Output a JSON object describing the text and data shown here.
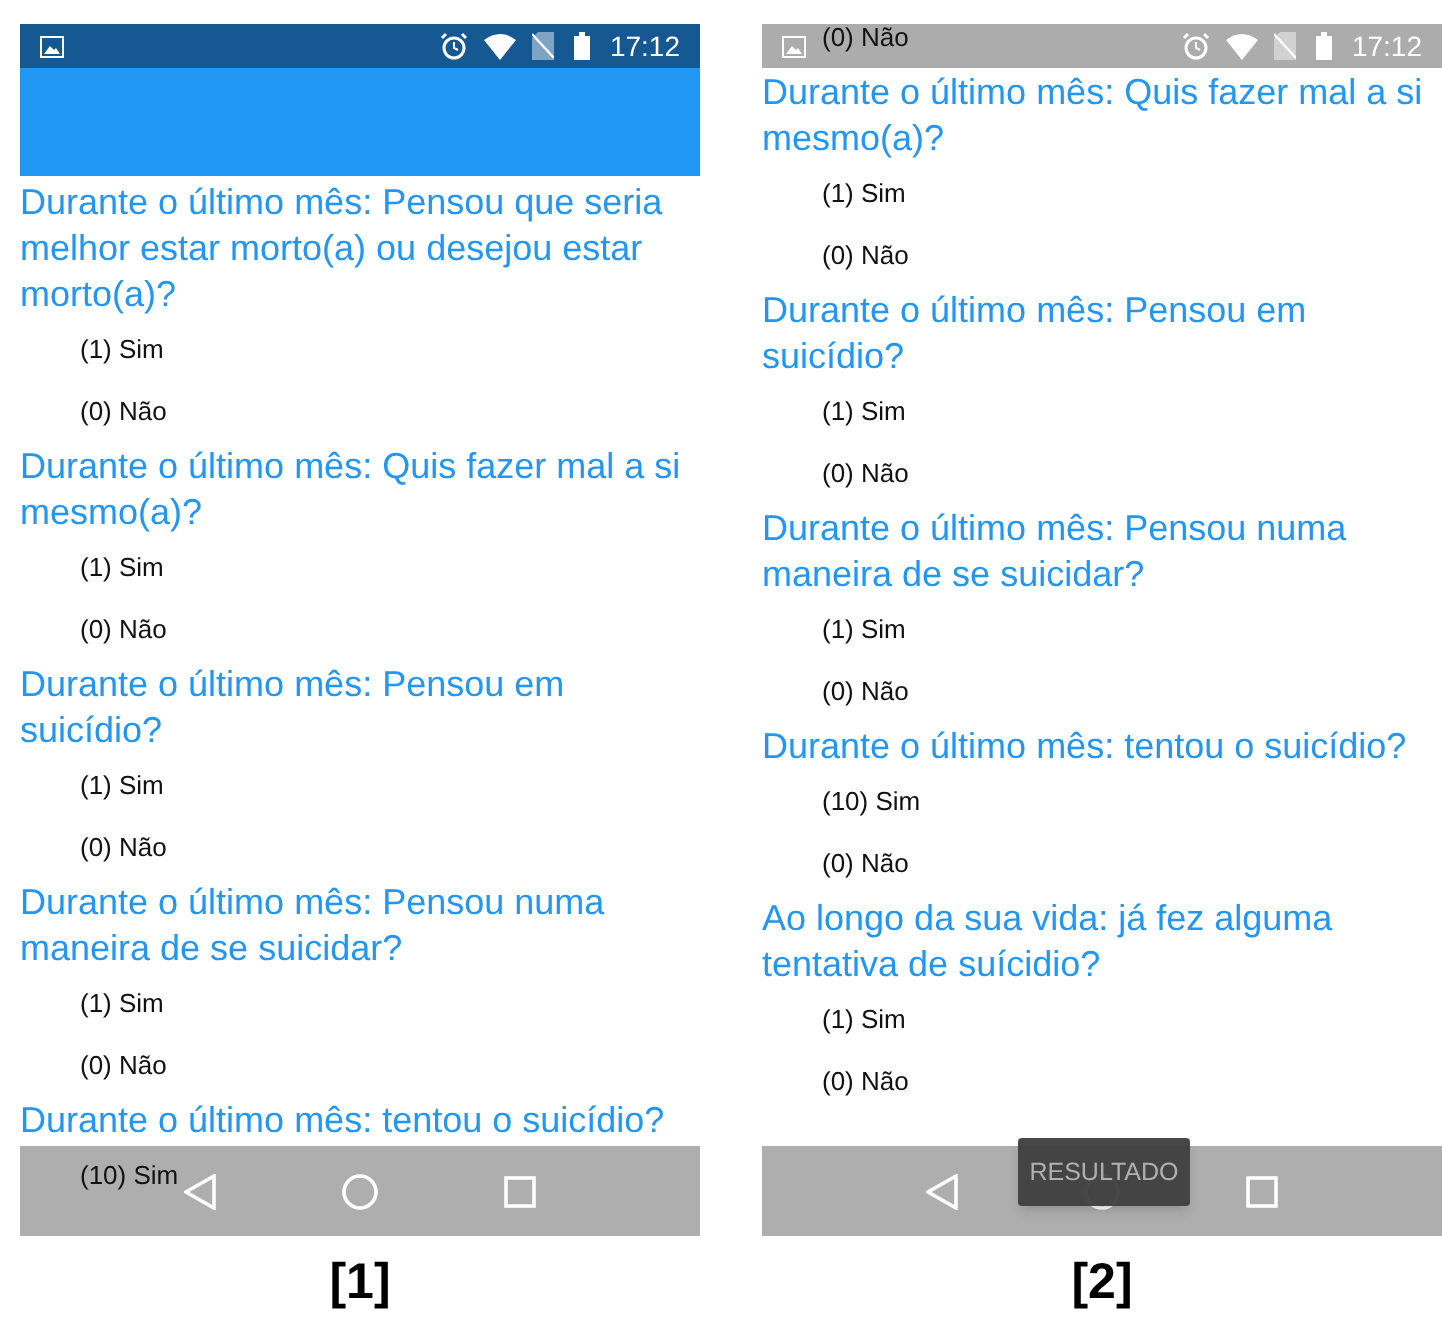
{
  "screens": [
    {
      "label": "[1]",
      "status_bar": {
        "time": "17:12",
        "translucent": false
      },
      "app_bar_visible": true,
      "items": [
        {
          "kind": "question",
          "text": "Durante o último mês: Pensou que seria melhor estar morto(a) ou desejou estar morto(a)?"
        },
        {
          "kind": "option",
          "text": "(1) Sim"
        },
        {
          "kind": "option",
          "text": "(0) Não"
        },
        {
          "kind": "question",
          "text": "Durante o último mês: Quis fazer mal a si mesmo(a)?"
        },
        {
          "kind": "option",
          "text": "(1) Sim"
        },
        {
          "kind": "option",
          "text": "(0) Não"
        },
        {
          "kind": "question",
          "text": "Durante o último mês: Pensou em suicídio?"
        },
        {
          "kind": "option",
          "text": "(1) Sim"
        },
        {
          "kind": "option",
          "text": "(0) Não"
        },
        {
          "kind": "question",
          "text": "Durante o último mês: Pensou numa maneira de se suicidar?"
        },
        {
          "kind": "option",
          "text": "(1) Sim"
        },
        {
          "kind": "option",
          "text": "(0) Não"
        },
        {
          "kind": "question",
          "text": "Durante o último mês: tentou o suicídio?"
        },
        {
          "kind": "option",
          "text": "(10) Sim"
        }
      ]
    },
    {
      "label": "[2]",
      "status_bar": {
        "time": "17:12",
        "translucent": true
      },
      "app_bar_visible": false,
      "floating_button": "RESULTADO",
      "items": [
        {
          "kind": "option",
          "text": "(0) Não"
        },
        {
          "kind": "question",
          "text": "Durante o último mês: Quis fazer mal a si mesmo(a)?"
        },
        {
          "kind": "option",
          "text": "(1) Sim"
        },
        {
          "kind": "option",
          "text": "(0) Não"
        },
        {
          "kind": "question",
          "text": "Durante o último mês: Pensou em suicídio?"
        },
        {
          "kind": "option",
          "text": "(1) Sim"
        },
        {
          "kind": "option",
          "text": "(0) Não"
        },
        {
          "kind": "question",
          "text": "Durante o último mês: Pensou numa maneira de se suicidar?"
        },
        {
          "kind": "option",
          "text": "(1) Sim"
        },
        {
          "kind": "option",
          "text": "(0) Não"
        },
        {
          "kind": "question",
          "text": "Durante o último mês: tentou o suicídio?"
        },
        {
          "kind": "option",
          "text": "(10) Sim"
        },
        {
          "kind": "option",
          "text": "(0) Não"
        },
        {
          "kind": "question",
          "text": "Ao longo da sua vida: já fez alguma tentativa de suícidio?"
        },
        {
          "kind": "option",
          "text": "(1) Sim"
        },
        {
          "kind": "option",
          "text": "(0) Não"
        }
      ]
    }
  ]
}
